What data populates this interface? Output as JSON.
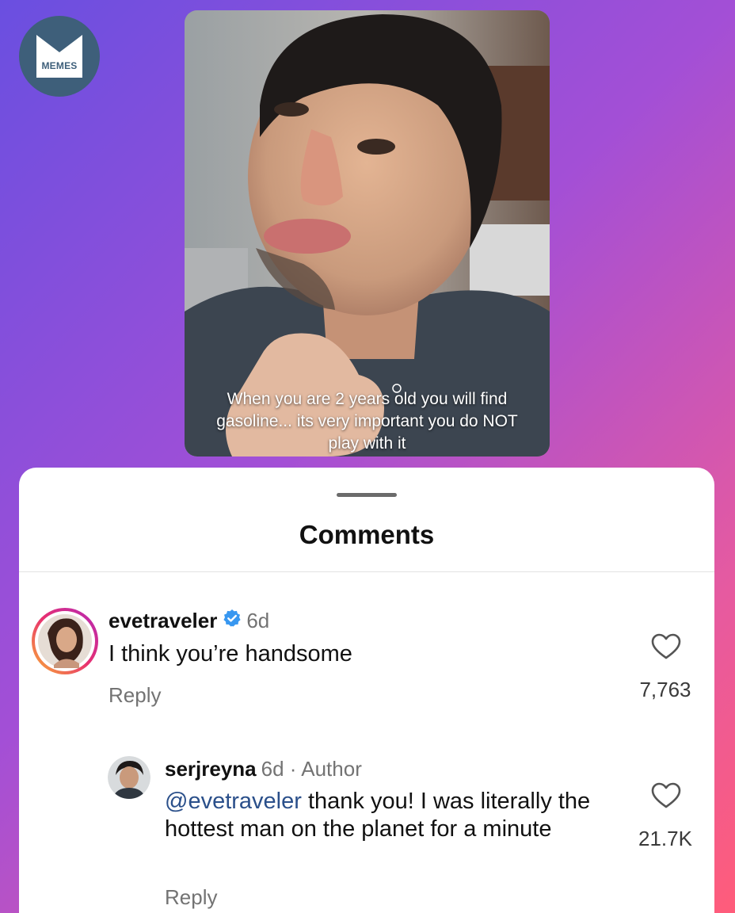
{
  "logo": {
    "text": "MEMES",
    "icon": "memes-m-logo"
  },
  "video": {
    "caption": "When you are 2 years old you will find gasoline... its very important you do NOT play with it"
  },
  "comments_sheet": {
    "title": "Comments",
    "comments": [
      {
        "username": "evetraveler",
        "verified": true,
        "age": "6d",
        "text": "I think you’re handsome",
        "reply_label": "Reply",
        "like_count": "7,763"
      },
      {
        "username": "serjreyna",
        "age": "6d · Author",
        "mention": "@evetraveler",
        "text": " thank you! I was literally the hottest man on the planet for a minute",
        "reply_label": "Reply",
        "like_count": "21.7K"
      }
    ]
  },
  "colors": {
    "background_start": "#6a4fe0",
    "background_end": "#ff5c7a",
    "mention": "#2a4f8a",
    "verified_badge": "#3897f0",
    "logo_bg": "#3e5f7a"
  }
}
